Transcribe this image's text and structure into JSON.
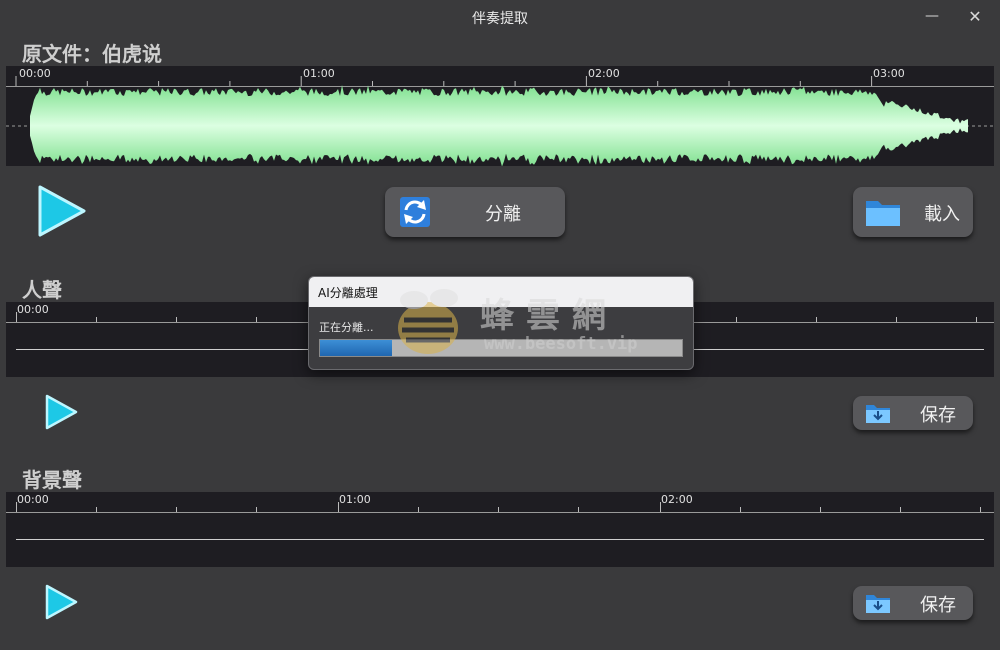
{
  "window": {
    "title": "伴奏提取",
    "minimize_glyph": "—",
    "close_glyph": "✕"
  },
  "original": {
    "label": "原文件：伯虎说",
    "ticks": [
      "00:00",
      "01:00",
      "02:00",
      "03:00"
    ],
    "wave_color": "#80e090",
    "wave_center_color": "#dcffe2"
  },
  "controls": {
    "separate_label": "分離",
    "load_label": "載入"
  },
  "vocals": {
    "label": "人聲",
    "ticks": [
      "00:00"
    ],
    "save_label": "保存"
  },
  "background": {
    "label": "背景聲",
    "ticks": [
      "00:00",
      "01:00",
      "02:00"
    ],
    "save_label": "保存"
  },
  "dialog": {
    "title": "AI分離處理",
    "status": "正在分離...",
    "progress": 0.2,
    "fill_color": "#2a78c4"
  },
  "watermark": {
    "cn": "蜂雲網",
    "url": "www.beesoft.vip"
  },
  "colors": {
    "accent_play": "#33d6ee",
    "icon_blue": "#3f9ae8"
  }
}
